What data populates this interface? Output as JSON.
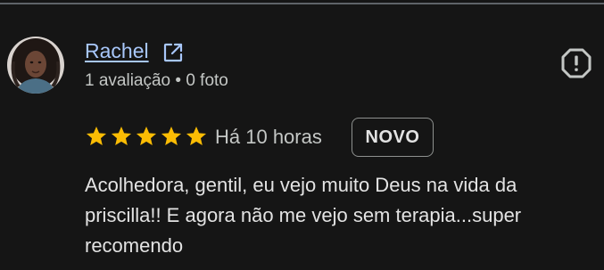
{
  "review": {
    "reviewer": {
      "name": "Rachel",
      "meta": "1 avaliação • 0 foto"
    },
    "rating": {
      "stars": 5,
      "max": 5,
      "star_color": "#fbbc04"
    },
    "time": "Há 10 horas",
    "badge": "NOVO",
    "text": "Acolhedora, gentil, eu vejo muito Deus na vida da priscilla!! E agora não me vejo sem terapia...super recomendo"
  },
  "icons": {
    "external_link": "external-link-icon",
    "report": "report-flag-icon"
  },
  "colors": {
    "background": "#151515",
    "link": "#a8c7fa",
    "text_primary": "#e3e3e3",
    "text_secondary": "#c4c7c5",
    "badge_border": "#8e918f"
  }
}
